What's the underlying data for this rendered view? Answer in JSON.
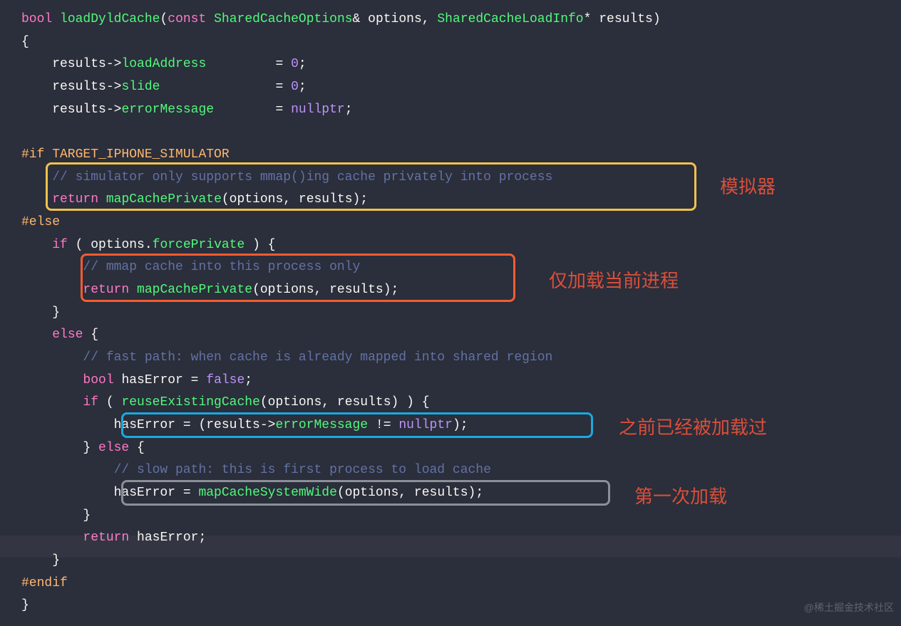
{
  "code": {
    "sig": {
      "bool": "bool",
      "fn": "loadDyldCache",
      "const": "const",
      "type1": "SharedCacheOptions",
      "amp_opt": "& options, ",
      "type2": "SharedCacheLoadInfo",
      "star_res": "* results)"
    },
    "l2": "{",
    "l3a": "    results->",
    "l3b": "loadAddress",
    "l3c": "         = ",
    "l3d": "0",
    "l4a": "    results->",
    "l4b": "slide",
    "l4c": "               = ",
    "l4d": "0",
    "l5a": "    results->",
    "l5b": "errorMessage",
    "l5c": "        = ",
    "l5d": "nullptr",
    "pre_if": "#if",
    "pre_if_cond": " TARGET_IPHONE_SIMULATOR",
    "c_sim": "    // simulator only supports mmap()ing cache privately into process",
    "ret": "return",
    "mapPriv": "mapCachePrivate",
    "args": "(options, results);",
    "pre_else": "#else",
    "if": "if",
    "opt_dot": " ( options.",
    "forcePriv": "forcePrivate",
    "close_if": " ) {",
    "c_mmap": "        // mmap cache into this process only",
    "else": "else",
    "c_fast": "        // fast path: when cache is already mapped into shared region",
    "bool2": "bool",
    "hasErr_decl": " hasError = ",
    "false": "false",
    "reuse": "reuseExistingCache",
    "args2": "(options, results) ) {",
    "hasErr_assign": "            hasError = (results->",
    "errMsg": "errorMessage",
    "neq": " != ",
    "nullptr2": "nullptr",
    "close_paren": ");",
    "c_slow": "            // slow path: this is first process to load cache",
    "hasErr_assign2": "            hasError = ",
    "mapSys": "mapCacheSystemWide",
    "ret_hasErr": " hasError;",
    "pre_endif": "#endif"
  },
  "annotations": {
    "sim": "模拟器",
    "current_proc": "仅加载当前进程",
    "loaded_before": "之前已经被加载过",
    "first_load": "第一次加载"
  },
  "watermark": "@稀土掘金技术社区"
}
